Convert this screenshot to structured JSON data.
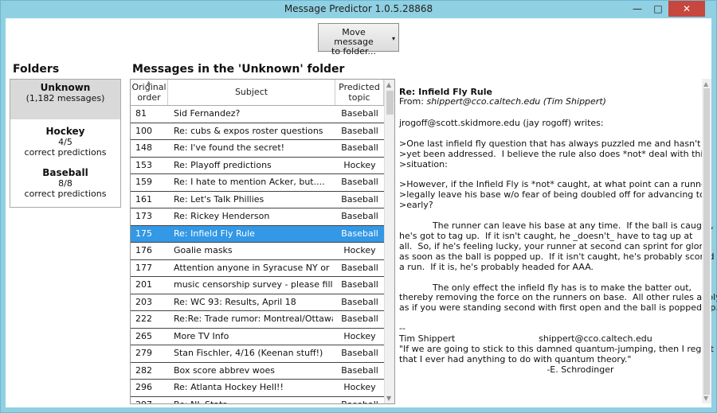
{
  "window": {
    "title": "Message Predictor 1.0.5.28868",
    "min": "—",
    "max": "□",
    "close": "✕"
  },
  "toolbar": {
    "move_label_1": "Move message",
    "move_label_2": "to folder...",
    "move_arrow": "▾"
  },
  "folders": {
    "header": "Folders",
    "items": [
      {
        "name": "Unknown",
        "detail": "(1,182 messages)"
      },
      {
        "name": "Hockey",
        "count": "4/5",
        "detail": "correct predictions"
      },
      {
        "name": "Baseball",
        "count": "8/8",
        "detail": "correct predictions"
      }
    ]
  },
  "messages": {
    "header": "Messages in the 'Unknown' folder",
    "columns": {
      "order_1": "Original",
      "order_2": "order",
      "subject": "Subject",
      "topic_1": "Predicted",
      "topic_2": "topic"
    },
    "rows": [
      {
        "order": "81",
        "subject": "Sid Fernandez?",
        "topic": "Baseball"
      },
      {
        "order": "100",
        "subject": "Re: cubs & expos roster questions",
        "topic": "Baseball"
      },
      {
        "order": "148",
        "subject": "Re: I've found the secret!",
        "topic": "Baseball"
      },
      {
        "order": "153",
        "subject": "Re: Playoff predictions",
        "topic": "Hockey"
      },
      {
        "order": "159",
        "subject": "Re: I hate to mention Acker, but....",
        "topic": "Baseball"
      },
      {
        "order": "161",
        "subject": "Re: Let's Talk Phillies",
        "topic": "Baseball"
      },
      {
        "order": "173",
        "subject": "Re: Rickey Henderson",
        "topic": "Baseball"
      },
      {
        "order": "175",
        "subject": "Re: Infield Fly Rule",
        "topic": "Baseball"
      },
      {
        "order": "176",
        "subject": "Goalie masks",
        "topic": "Hockey"
      },
      {
        "order": "177",
        "subject": "Attention anyone in Syracuse NY or Richmond",
        "topic": "Baseball"
      },
      {
        "order": "201",
        "subject": "music censorship survey - please fill out",
        "topic": "Baseball"
      },
      {
        "order": "203",
        "subject": "Re: WC 93: Results, April 18",
        "topic": "Baseball"
      },
      {
        "order": "222",
        "subject": "Re:Re: Trade rumor: Montreal/Ottawa/Phillies",
        "topic": "Baseball"
      },
      {
        "order": "265",
        "subject": "More TV Info",
        "topic": "Hockey"
      },
      {
        "order": "279",
        "subject": "Stan Fischler, 4/16 (Keenan stuff!)",
        "topic": "Baseball"
      },
      {
        "order": "282",
        "subject": "Box score abbrev woes",
        "topic": "Baseball"
      },
      {
        "order": "296",
        "subject": "Re: Atlanta Hockey Hell!!",
        "topic": "Hockey"
      },
      {
        "order": "297",
        "subject": "Re: NL Stats",
        "topic": "Baseball"
      }
    ],
    "selected_index": 7
  },
  "preview": {
    "subject": "Re: Infield Fly Rule",
    "from_label": "From:",
    "from_addr": "shippert@cco.caltech.edu (Tim Shippert)",
    "body": "jrogoff@scott.skidmore.edu (jay rogoff) writes:\n\n>One last infield fly question that has always puzzled me and hasn't\n>yet been addressed.  I believe the rule also does *not* deal with this\n>situation:\n\n>However, if the Infield Fly is *not* caught, at what point can a runner\n>legally leave his base w/o fear of being doubled off for advancing too\n>early?\n\n            The runner can leave his base at any time.  If the ball is caught,\nhe's got to tag up.  If it isn't caught, he _doesn't_ have to tag up at\nall.  So, if he's feeling lucky, your runner at second can sprint for glory\nas soon as the ball is popped up.  If it isn't caught, he's probably scored\na run.  If it is, he's probably headed for AAA.\n\n            The only effect the infield fly has is to make the batter out,\nthereby removing the force on the runners on base.  All other rules apply,\nas if you were standing second with first open and the ball is popped up.\n\n--\nTim Shippert                              shippert@cco.caltech.edu\n\"If we are going to stick to this damned quantum-jumping, then I regret\nthat I ever had anything to do with quantum theory.\"\n                                                     -E. Schrodinger"
  },
  "colors": {
    "accent": "#3398e5",
    "chrome": "#8fd0e2",
    "close": "#c7463e"
  }
}
